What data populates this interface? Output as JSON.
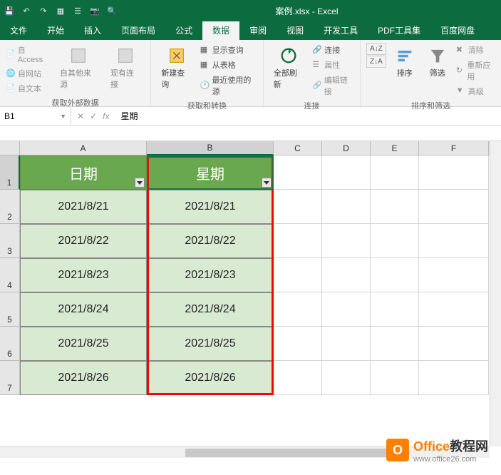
{
  "title": "案例.xlsx - Excel",
  "tabs": [
    "文件",
    "开始",
    "插入",
    "页面布局",
    "公式",
    "数据",
    "审阅",
    "视图",
    "开发工具",
    "PDF工具集",
    "百度网盘"
  ],
  "active_tab": 5,
  "ribbon": {
    "g1": {
      "items": [
        "自 Access",
        "自网站",
        "自文本"
      ],
      "big1": "自其他来源",
      "big2": "现有连接",
      "label": "获取外部数据"
    },
    "g2": {
      "big": "新建查询",
      "items": [
        "显示查询",
        "从表格",
        "最近使用的源"
      ],
      "label": "获取和转换"
    },
    "g3": {
      "big": "全部刷新",
      "items": [
        "连接",
        "属性",
        "编辑链接"
      ],
      "label": "连接"
    },
    "g4": {
      "btn1": "↓A Z",
      "btn2": "↑Z A",
      "big": "排序",
      "big2": "筛选",
      "items": [
        "清除",
        "重新应用",
        "高级"
      ],
      "label": "排序和筛选"
    }
  },
  "namebox": "B1",
  "formula": "星期",
  "cols": [
    "A",
    "B",
    "C",
    "D",
    "E",
    "F"
  ],
  "headers": {
    "A": "日期",
    "B": "星期"
  },
  "chart_data": {
    "type": "table",
    "columns": [
      "日期",
      "星期"
    ],
    "rows": [
      [
        "2021/8/21",
        "2021/8/21"
      ],
      [
        "2021/8/22",
        "2021/8/22"
      ],
      [
        "2021/8/23",
        "2021/8/23"
      ],
      [
        "2021/8/24",
        "2021/8/24"
      ],
      [
        "2021/8/25",
        "2021/8/25"
      ],
      [
        "2021/8/26",
        "2021/8/26"
      ]
    ]
  },
  "watermark": {
    "brand1": "Office",
    "brand2": "教程网",
    "url": "www.office26.com"
  }
}
